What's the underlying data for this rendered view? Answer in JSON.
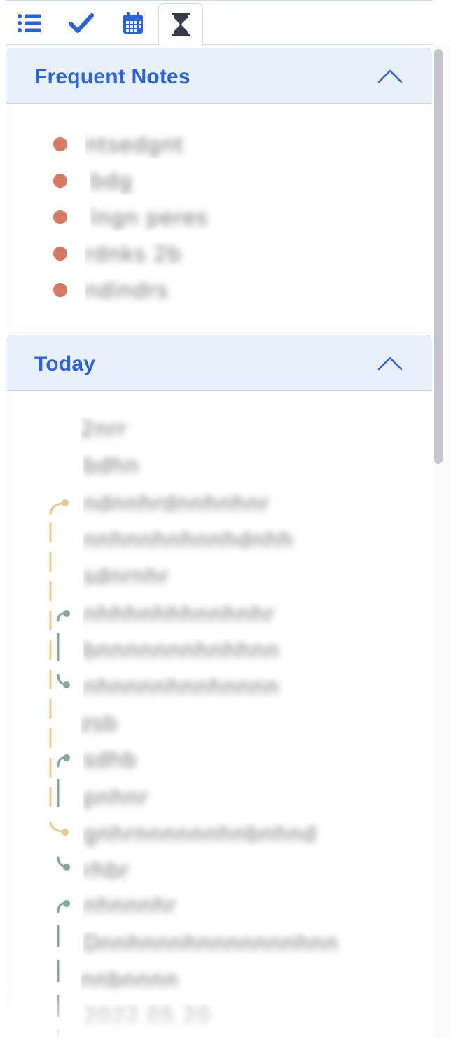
{
  "tabs": [
    {
      "icon": "list-icon",
      "color": "#2d63d8"
    },
    {
      "icon": "checkmark-icon",
      "color": "#2d63d8"
    },
    {
      "icon": "calendar-icon",
      "color": "#2d63d8"
    },
    {
      "icon": "hourglass-icon",
      "color": "#363b44",
      "active": true
    }
  ],
  "sections": {
    "frequent": {
      "title": "Frequent Notes",
      "expanded": true
    },
    "today": {
      "title": "Today",
      "expanded": true
    }
  },
  "frequent_notes": [
    {
      "text": "ntsedgnt"
    },
    {
      "text": "bdg"
    },
    {
      "text": "lngn peres"
    },
    {
      "text": "rdnks 2b"
    },
    {
      "text": "ndindrs"
    }
  ],
  "today_notes": [
    {
      "text": "2nrr"
    },
    {
      "text": "bdhn"
    },
    {
      "text": "ndnnhrdnnhnhnr"
    },
    {
      "text": "nnhnnhnhnnhdnhh"
    },
    {
      "text": "sdnrnhr"
    },
    {
      "text": "nhhhnhhhnnhnhr"
    },
    {
      "text": "bnnnnnnnhnhhnn"
    },
    {
      "text": "nhnnnnhnnhnnnn"
    },
    {
      "text": "zsb"
    },
    {
      "text": "sdhb"
    },
    {
      "text": "pnhnr"
    },
    {
      "text": "gnhrnnnnnnhnbnhnd"
    },
    {
      "text": "rhbr"
    },
    {
      "text": "nhnnnhr"
    },
    {
      "text": "Dnnhnnnhnnnnnnnhnn"
    },
    {
      "text": "nnbnnnn"
    },
    {
      "text": "2022 05 20"
    }
  ],
  "colors": {
    "accent": "#2d63d8",
    "header_bg": "#e8f0fc",
    "dot": "#d47a63",
    "link_yellow": "#e8c98e",
    "link_green": "#86a995"
  }
}
